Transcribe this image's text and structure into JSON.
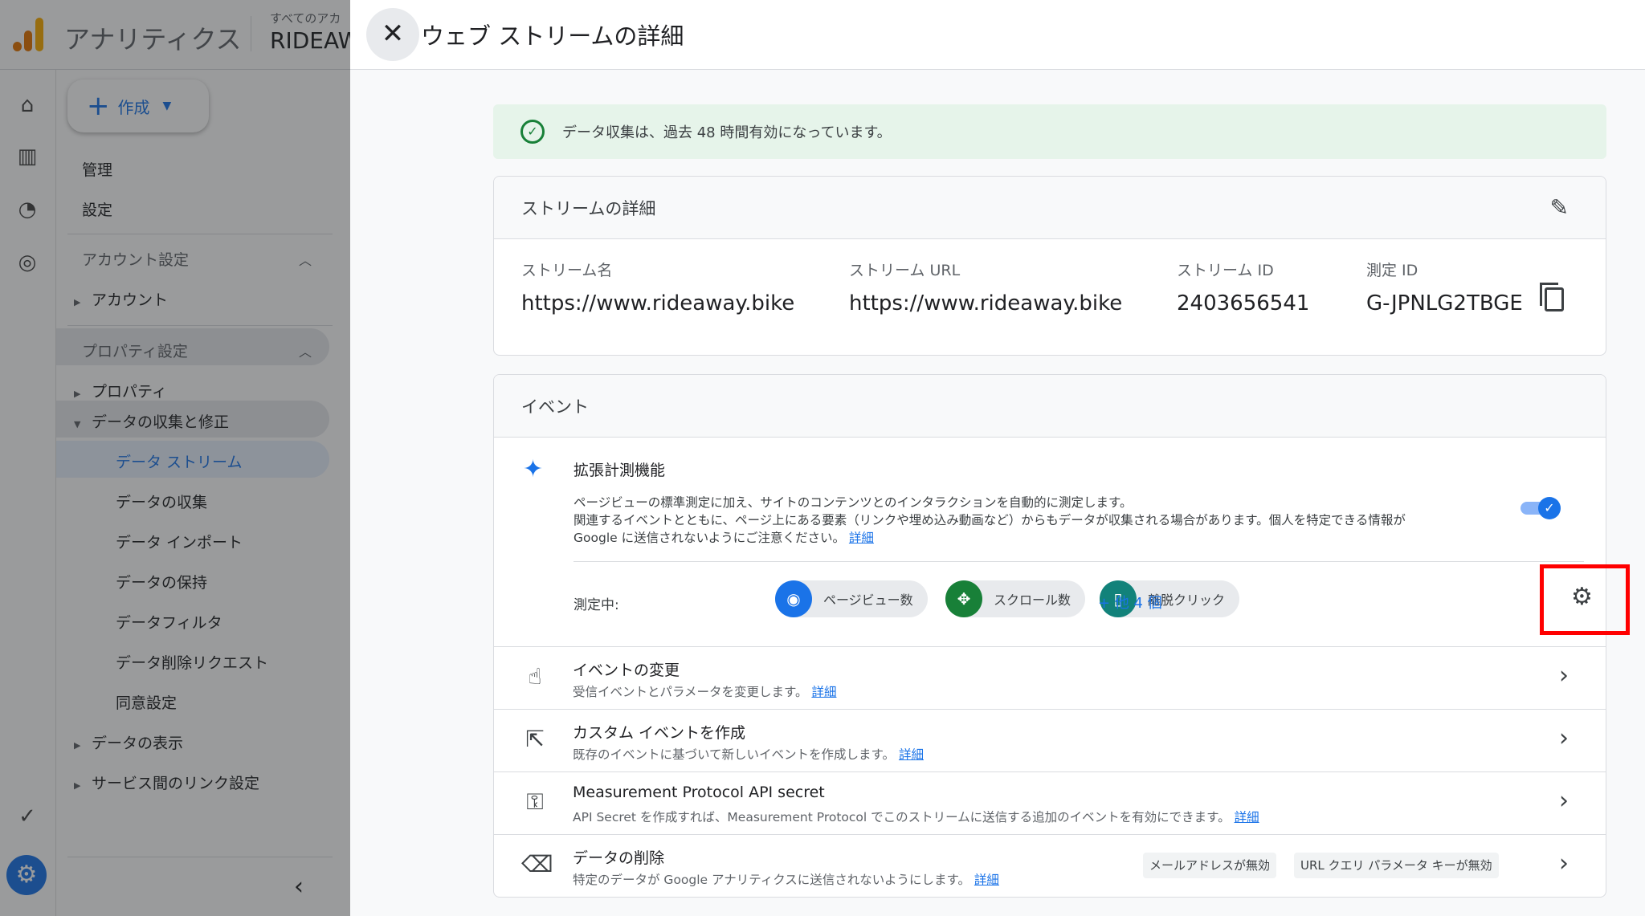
{
  "app": {
    "name": "アナリティクス",
    "account_small": "すべてのアカ",
    "account_big": "RIDEAW"
  },
  "sidenav": {
    "create_label": "作成",
    "items": {
      "admin": "管理",
      "settings": "設定",
      "account_settings": "アカウント設定",
      "account": "アカウント",
      "property_settings": "プロパティ設定",
      "property": "プロパティ",
      "data_collection_modify": "データの収集と修正",
      "data_streams": "データ ストリーム",
      "data_collection": "データの収集",
      "data_import": "データ インポート",
      "data_retention": "データの保持",
      "data_filters": "データフィルタ",
      "data_deletion_requests": "データ削除リクエスト",
      "consent_settings": "同意設定",
      "data_display": "データの表示",
      "product_links": "サービス間のリンク設定"
    }
  },
  "panel": {
    "title": "ウェブ ストリームの詳細",
    "banner": "データ収集は、過去 48 時間有効になっています。",
    "stream_details": {
      "heading": "ストリームの詳細",
      "columns": [
        {
          "label": "ストリーム名",
          "value": "https://www.rideaway.bike"
        },
        {
          "label": "ストリーム URL",
          "value": "https://www.rideaway.bike"
        },
        {
          "label": "ストリーム ID",
          "value": "2403656541"
        },
        {
          "label": "測定 ID",
          "value": "G-JPNLG2TBGE"
        }
      ]
    },
    "events": {
      "heading": "イベント",
      "enhanced": {
        "title": "拡張計測機能",
        "line1": "ページビューの標準測定に加え、サイトのコンテンツとのインタラクションを自動的に測定します。",
        "line2": "関連するイベントとともに、ページ上にある要素（リンクや埋め込み動画など）からもデータが収集される場合があります。個人を特定できる情報が",
        "line3": "Google に送信されないようにご注意ください。",
        "learn_more": "詳細",
        "toggle_on": true,
        "measuring_label": "測定中:",
        "chips": [
          "ページビュー数",
          "スクロール数",
          "離脱クリック"
        ],
        "more": "+ 他 4 個"
      },
      "rows": [
        {
          "title": "イベントの変更",
          "sub": "受信イベントとパラメータを変更します。",
          "link": "詳細"
        },
        {
          "title": "カスタム イベントを作成",
          "sub": "既存のイベントに基づいて新しいイベントを作成します。",
          "link": "詳細"
        },
        {
          "title": "Measurement Protocol API secret",
          "sub": "API Secret を作成すれば、Measurement Protocol でこのストリームに送信する追加のイベントを有効にできます。",
          "link": "詳細"
        },
        {
          "title": "データの削除",
          "sub": "特定のデータが Google アナリティクスに送信されないようにします。",
          "link": "詳細",
          "badges": [
            "メールアドレスが無効",
            "URL クエリ パラメータ キーが無効"
          ]
        }
      ]
    }
  },
  "colors": {
    "accent": "#1a73e8",
    "success": "#188038",
    "highlight_box": "#ff0000"
  }
}
